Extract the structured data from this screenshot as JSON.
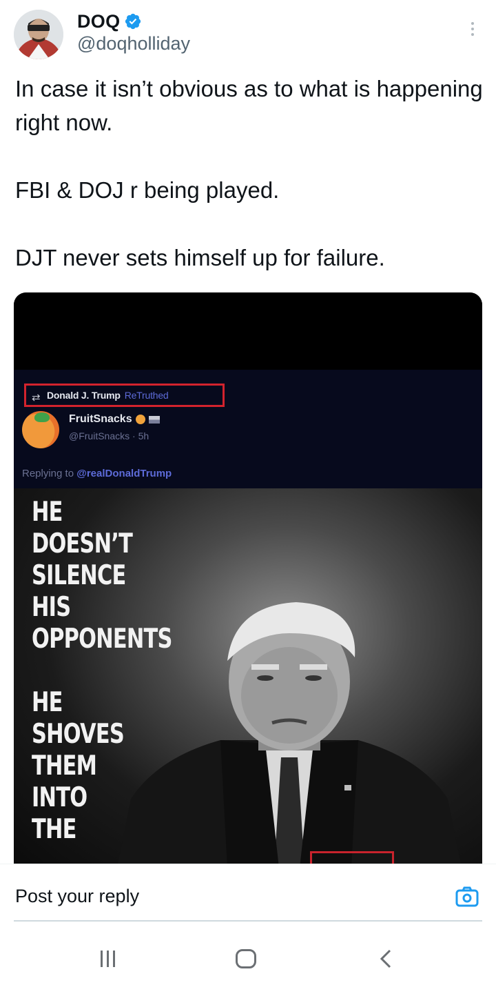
{
  "header": {
    "display_name": "DOQ",
    "handle": "@doqholliday",
    "verified_icon": "verified-badge-icon",
    "more_icon": "more-vertical-icon",
    "accent_color": "#1d9bf0"
  },
  "tweet": {
    "text": "In case it isn’t obvious as to what is happening right now.\n\nFBI & DOJ r being played.\n\nDJT never sets himself up for failure."
  },
  "media": {
    "retruth_name": "Donald J. Trump",
    "retruth_label": "ReTruthed",
    "author_name": "FruitSnacks",
    "author_meta": "@FruitSnacks · 5h",
    "reply_prefix": "Replying to",
    "reply_handle": "@realDonaldTrump",
    "overlay_text": "HE\nDOESN’T\nSILENCE\nHIS\nOPPONENTS\n\nHE\nSHOVES\nTHEM\nINTO\nTHE"
  },
  "reply_bar": {
    "placeholder": "Post your reply",
    "camera_icon": "camera-icon"
  },
  "system_nav": {
    "recent_icon": "recent-apps-icon",
    "home_icon": "home-icon",
    "back_icon": "back-icon"
  }
}
